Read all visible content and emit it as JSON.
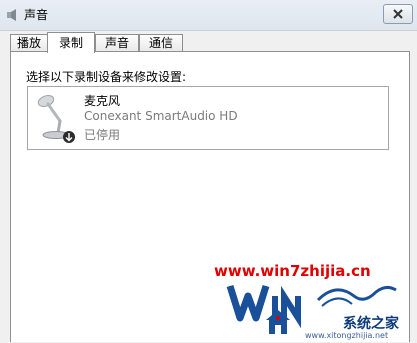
{
  "window": {
    "title": "声音"
  },
  "tabs": [
    {
      "label": "播放"
    },
    {
      "label": "录制"
    },
    {
      "label": "声音"
    },
    {
      "label": "通信"
    }
  ],
  "recording": {
    "instruction": "选择以下录制设备来修改设置:",
    "devices": [
      {
        "name": "麦克风",
        "driver": "Conexant SmartAudio HD",
        "status": "已停用",
        "icon": "microphone-icon"
      }
    ]
  },
  "watermark": {
    "url": "www.win7zhijia.cn",
    "brand": "系统之家",
    "site": "www.xitongzhijia.net",
    "colors": {
      "url": "#e00000",
      "logo": "#1a4f99"
    }
  }
}
